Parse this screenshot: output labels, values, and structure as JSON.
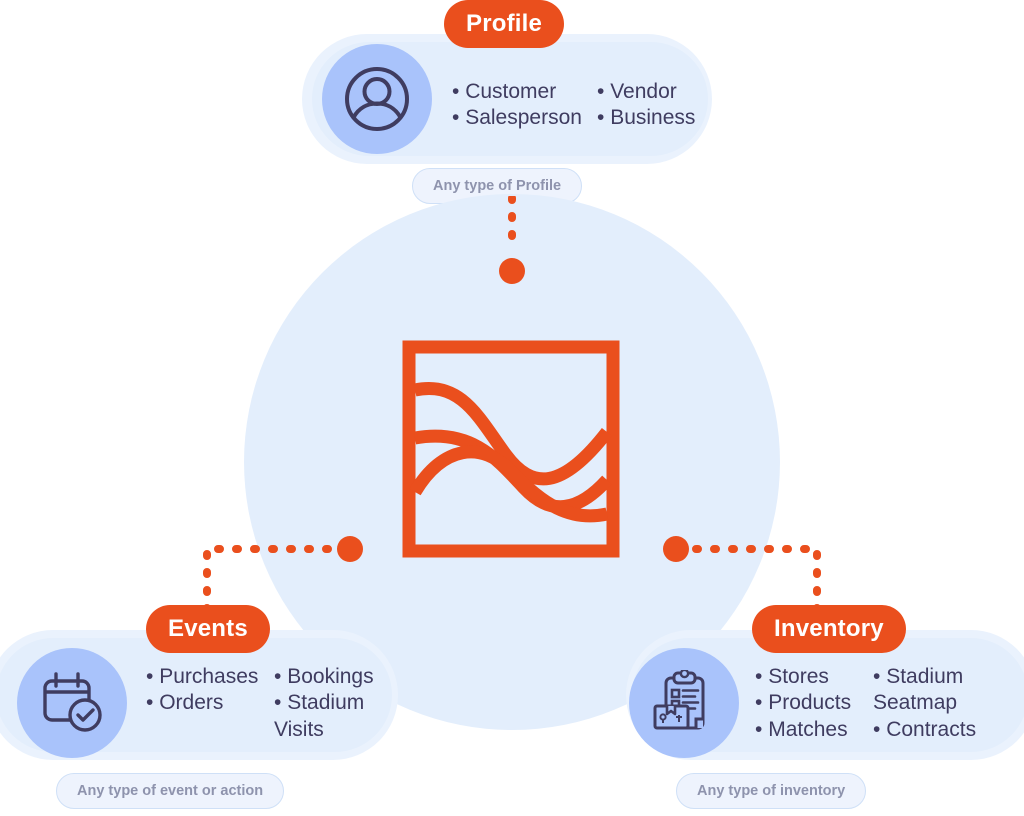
{
  "diagram": {
    "center": {
      "logo_name": "data-waves-square-logo",
      "accent_color": "#ea4f1d",
      "hub_bg_color": "#e3eefc"
    },
    "nodes": [
      {
        "id": "profile",
        "badge": "Profile",
        "icon": "user-avatar-icon",
        "caption": "Any type of Profile",
        "columns": [
          [
            "Customer",
            "Salesperson"
          ],
          [
            "Vendor",
            "Business"
          ]
        ]
      },
      {
        "id": "events",
        "badge": "Events",
        "icon": "calendar-check-icon",
        "caption": "Any type of event or action",
        "columns": [
          [
            "Purchases",
            "Orders"
          ],
          [
            "Bookings",
            "Stadium Visits"
          ]
        ]
      },
      {
        "id": "inventory",
        "badge": "Inventory",
        "icon": "clipboard-box-icon",
        "caption": "Any type of inventory",
        "columns": [
          [
            "Stores",
            "Products",
            "Matches"
          ],
          [
            "Stadium Seatmap",
            "Contracts"
          ]
        ]
      }
    ],
    "bullet_char": "•"
  }
}
